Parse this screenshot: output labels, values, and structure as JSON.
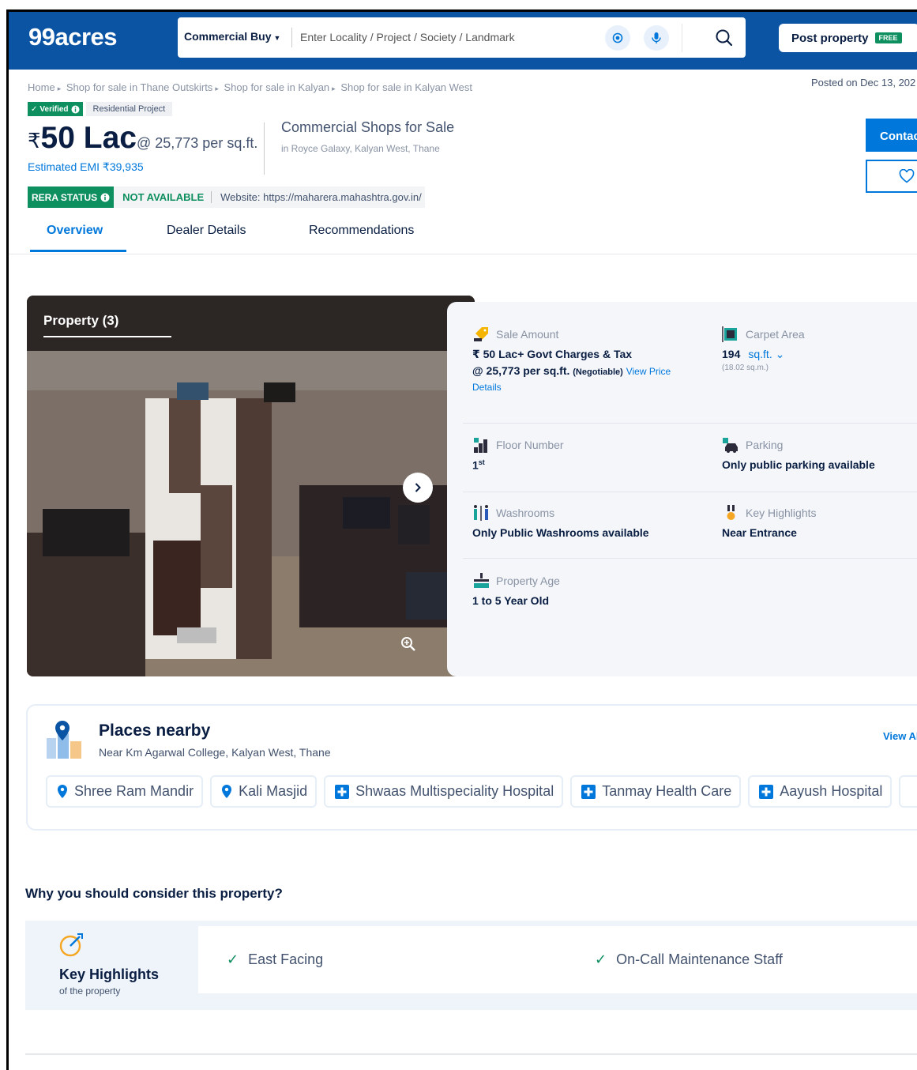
{
  "header": {
    "logo": "99acres",
    "search_type": "Commercial Buy",
    "search_placeholder": "Enter Locality / Project / Society / Landmark",
    "post_property": "Post property",
    "free_badge": "FREE"
  },
  "breadcrumb": [
    "Home",
    "Shop for sale in Thane Outskirts",
    "Shop for sale in Kalyan",
    "Shop for sale in Kalyan West"
  ],
  "posted": "Posted on Dec 13, 202",
  "badges": {
    "verified": "Verified",
    "project": "Residential Project"
  },
  "price": {
    "currency": "₹",
    "amount": "50 Lac",
    "per_sqft": "@ 25,773 per sq.ft.",
    "emi": "Estimated EMI ₹39,935"
  },
  "property": {
    "title": "Commercial Shops for Sale",
    "location": "in Royce Galaxy, Kalyan West, Thane"
  },
  "actions": {
    "contact": "Contac"
  },
  "rera": {
    "status_label": "RERA STATUS",
    "status_value": "NOT AVAILABLE",
    "website": "Website: https://maharera.mahashtra.gov.in/"
  },
  "tabs": [
    "Overview",
    "Dealer Details",
    "Recommendations"
  ],
  "gallery": {
    "title": "Property (3)"
  },
  "details": {
    "sale_amount_label": "Sale Amount",
    "sale_amount_value": "₹ 50 Lac+ Govt Charges & Tax",
    "sale_rate": "@ 25,773 per sq.ft.",
    "negotiable": "(Negotiable)",
    "view_price": "View Price",
    "details_link": "Details",
    "carpet_label": "Carpet Area",
    "carpet_value": "194",
    "carpet_unit": "sq.ft.",
    "carpet_sqm": "(18.02 sq.m.)",
    "floor_label": "Floor Number",
    "floor_value": "1",
    "floor_suffix": "st",
    "parking_label": "Parking",
    "parking_value": "Only public parking available",
    "washroom_label": "Washrooms",
    "washroom_value": "Only Public Washrooms available",
    "highlights_label": "Key Highlights",
    "highlights_value": "Near Entrance",
    "age_label": "Property Age",
    "age_value": "1 to 5 Year Old"
  },
  "places": {
    "title": "Places nearby",
    "subtitle": "Near Km Agarwal College, Kalyan West, Thane",
    "view_all": "View Al",
    "items": [
      {
        "name": "Shree Ram Mandir",
        "icon": "location-pin-icon"
      },
      {
        "name": "Kali Masjid",
        "icon": "location-pin-icon"
      },
      {
        "name": "Shwaas Multispeciality Hospital",
        "icon": "hospital-icon"
      },
      {
        "name": "Tanmay Health Care",
        "icon": "hospital-icon"
      },
      {
        "name": "Aayush Hospital",
        "icon": "hospital-icon"
      }
    ]
  },
  "why": {
    "heading": "Why you should consider this property?",
    "kh_title": "Key Highlights",
    "kh_sub": "of the property",
    "items": [
      "East Facing",
      "On-Call Maintenance Staff"
    ]
  },
  "colors": {
    "brand": "#0b54a4",
    "accent": "#0078db",
    "green": "#0e8f5f"
  }
}
